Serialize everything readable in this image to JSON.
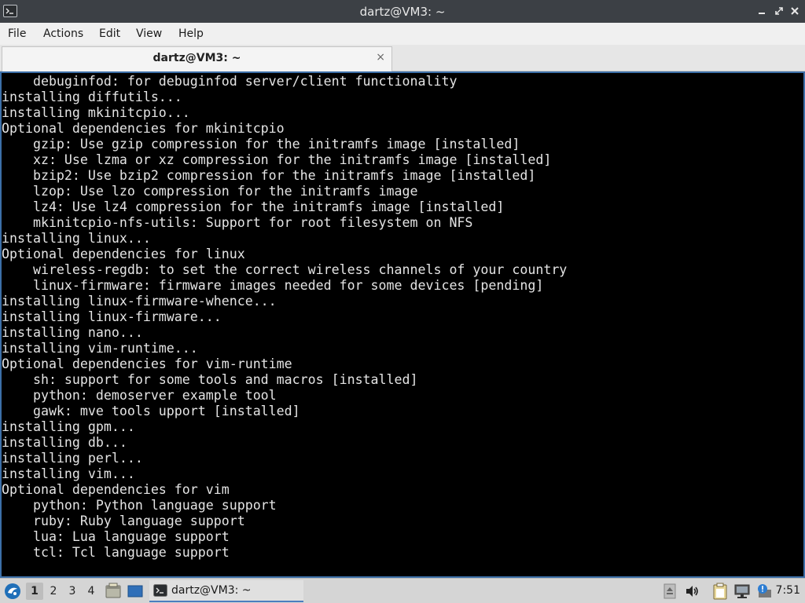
{
  "window": {
    "title": "dartz@VM3: ~"
  },
  "menu": {
    "file": "File",
    "actions": "Actions",
    "edit": "Edit",
    "view": "View",
    "help": "Help"
  },
  "tab": {
    "label": "dartz@VM3: ~",
    "close_glyph": "×"
  },
  "terminal": {
    "lines": [
      "    debuginfod: for debuginfod server/client functionality",
      "installing diffutils...",
      "installing mkinitcpio...",
      "Optional dependencies for mkinitcpio",
      "    gzip: Use gzip compression for the initramfs image [installed]",
      "    xz: Use lzma or xz compression for the initramfs image [installed]",
      "    bzip2: Use bzip2 compression for the initramfs image [installed]",
      "    lzop: Use lzo compression for the initramfs image",
      "    lz4: Use lz4 compression for the initramfs image [installed]",
      "    mkinitcpio-nfs-utils: Support for root filesystem on NFS",
      "installing linux...",
      "Optional dependencies for linux",
      "    wireless-regdb: to set the correct wireless channels of your country",
      "    linux-firmware: firmware images needed for some devices [pending]",
      "installing linux-firmware-whence...",
      "installing linux-firmware...",
      "installing nano...",
      "installing vim-runtime...",
      "Optional dependencies for vim-runtime",
      "    sh: support for some tools and macros [installed]",
      "    python: demoserver example tool",
      "    gawk: mve tools upport [installed]",
      "installing gpm...",
      "installing db...",
      "installing perl...",
      "installing vim...",
      "Optional dependencies for vim",
      "    python: Python language support",
      "    ruby: Ruby language support",
      "    lua: Lua language support",
      "    tcl: Tcl language support"
    ]
  },
  "taskbar": {
    "workspaces": [
      "1",
      "2",
      "3",
      "4"
    ],
    "active_workspace": "1",
    "task_label": "dartz@VM3: ~",
    "clock": "7:51"
  },
  "colors": {
    "titlebar": "#3c4045",
    "terminal_bg": "#000000",
    "terminal_fg": "#e4e4e4",
    "terminal_border": "#3c6fa8",
    "taskbar": "#d5d5d5",
    "task_underline": "#4a7dbf"
  },
  "icons": {
    "app": "terminal-icon",
    "minimize": "minimize-icon",
    "maximize": "maximize-icon",
    "close": "close-icon",
    "launcher": "lubuntu-logo-icon",
    "file_manager": "file-manager-icon",
    "show_desktop": "show-desktop-icon",
    "tray": [
      "eject-icon",
      "volume-icon",
      "clipboard-icon",
      "network-icon",
      "notification-icon"
    ]
  }
}
